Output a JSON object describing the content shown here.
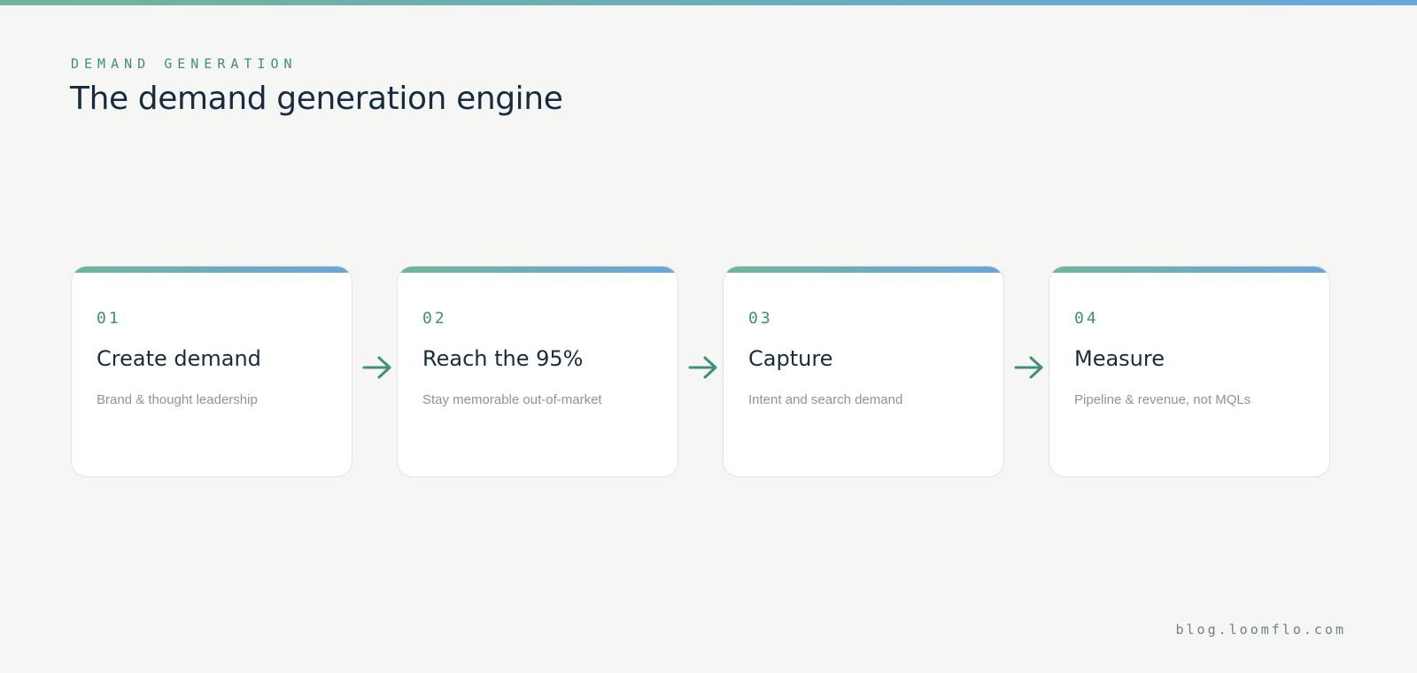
{
  "header": {
    "eyebrow": "DEMAND GENERATION",
    "title": "The demand generation engine"
  },
  "steps": [
    {
      "number": "01",
      "title": "Create demand",
      "subtitle": "Brand & thought leadership"
    },
    {
      "number": "02",
      "title": "Reach the 95%",
      "subtitle": "Stay memorable out-of-market"
    },
    {
      "number": "03",
      "title": "Capture",
      "subtitle": "Intent and search demand"
    },
    {
      "number": "04",
      "title": "Measure",
      "subtitle": "Pipeline & revenue, not MQLs"
    }
  ],
  "arrow_icon": "arrow-right-icon",
  "footer": {
    "site": "blog.loomflo.com"
  },
  "colors": {
    "accent_green": "#6fb59a",
    "accent_blue": "#6aa6dc",
    "arrow": "#3f8f7d",
    "title": "#172c40",
    "background": "#f6f6f4"
  }
}
